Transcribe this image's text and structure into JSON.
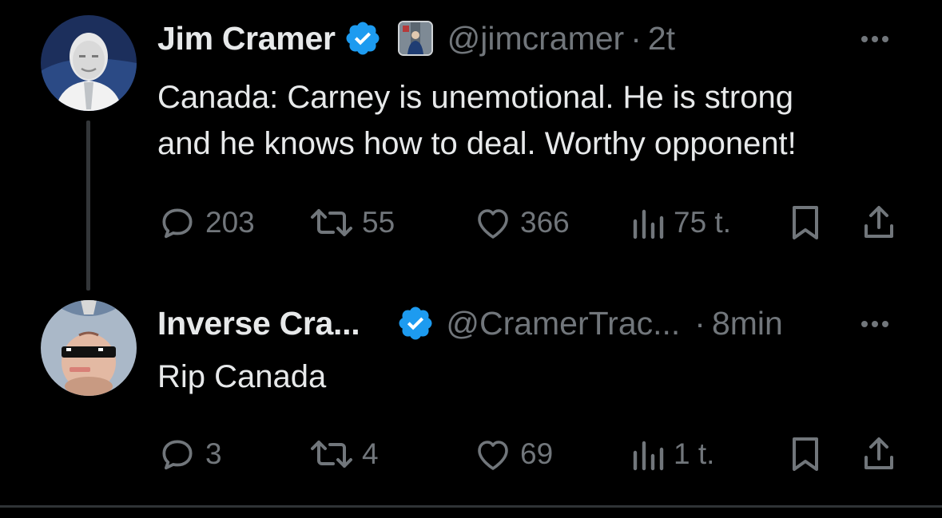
{
  "tweets": [
    {
      "author_name": "Jim Cramer",
      "handle": "@jimcramer",
      "separator": "·",
      "time": "2t",
      "text": "Canada: Carney is unemotional. He is strong\nand he knows how to deal. Worthy opponent!",
      "replies": "203",
      "reposts": "55",
      "likes": "366",
      "views": "75 t."
    },
    {
      "author_name": "Inverse Cra...",
      "handle": "@CramerTrac...",
      "separator": "·",
      "time": "8min",
      "text": "Rip Canada",
      "replies": "3",
      "reposts": "4",
      "likes": "69",
      "views": "1 t."
    }
  ],
  "icons": {
    "verified": "verified-badge-icon",
    "reply": "reply-icon",
    "repost": "repost-icon",
    "like": "heart-icon",
    "views": "views-icon",
    "bookmark": "bookmark-icon",
    "share": "share-icon",
    "more": "more-icon"
  },
  "colors": {
    "background": "#000000",
    "primary_text": "#e7e9ea",
    "secondary_text": "#71767b",
    "verified_blue": "#1d9bf0",
    "thread_line": "#333639"
  }
}
